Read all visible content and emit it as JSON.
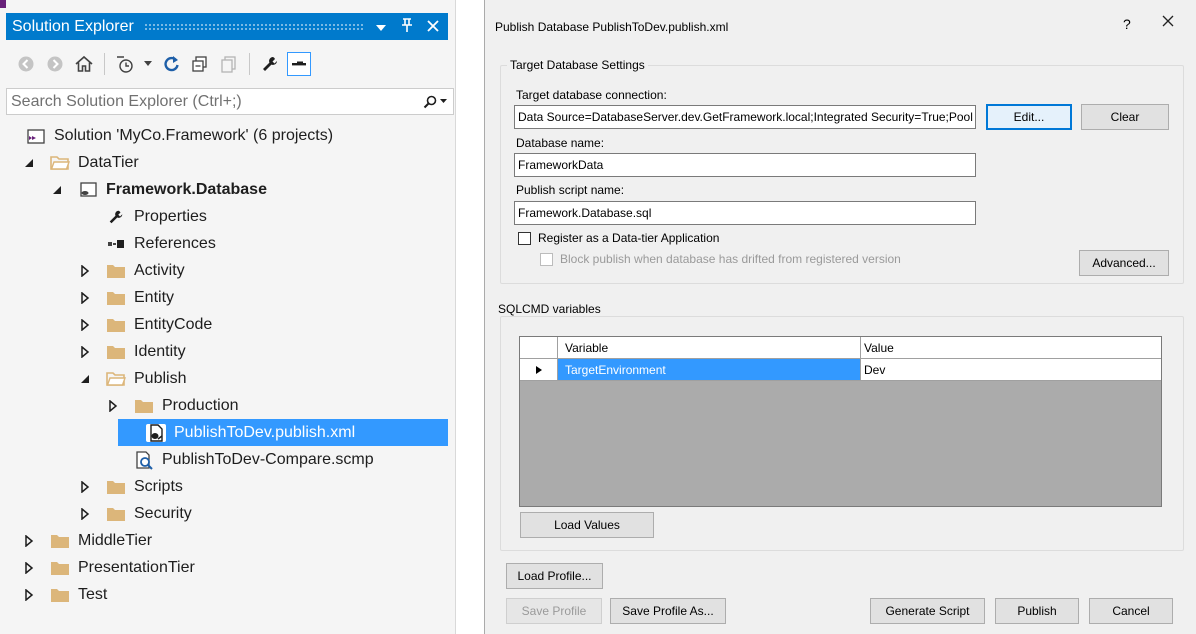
{
  "solution_explorer": {
    "title": "Solution Explorer",
    "search_placeholder": "Search Solution Explorer (Ctrl+;)",
    "tree": [
      {
        "label": "Solution 'MyCo.Framework' (6 projects)",
        "icon": "solution-icon",
        "level": 0,
        "expander": "none",
        "bold": false
      },
      {
        "label": "DataTier",
        "icon": "folder-open-icon",
        "level": 0,
        "expander": "expanded",
        "bold": false
      },
      {
        "label": "Framework.Database",
        "icon": "database-project-icon",
        "level": 1,
        "expander": "expanded",
        "bold": true
      },
      {
        "label": "Properties",
        "icon": "wrench-icon",
        "level": 2,
        "expander": "none",
        "bold": false
      },
      {
        "label": "References",
        "icon": "references-icon",
        "level": 2,
        "expander": "none",
        "bold": false
      },
      {
        "label": "Activity",
        "icon": "folder-icon",
        "level": 2,
        "expander": "collapsed",
        "bold": false
      },
      {
        "label": "Entity",
        "icon": "folder-icon",
        "level": 2,
        "expander": "collapsed",
        "bold": false
      },
      {
        "label": "EntityCode",
        "icon": "folder-icon",
        "level": 2,
        "expander": "collapsed",
        "bold": false
      },
      {
        "label": "Identity",
        "icon": "folder-icon",
        "level": 2,
        "expander": "collapsed",
        "bold": false
      },
      {
        "label": "Publish",
        "icon": "folder-open-icon",
        "level": 2,
        "expander": "expanded",
        "bold": false
      },
      {
        "label": "Production",
        "icon": "folder-icon",
        "level": 3,
        "expander": "collapsed",
        "bold": false
      },
      {
        "label": "PublishToDev.publish.xml",
        "icon": "publish-file-icon",
        "level": 3,
        "expander": "none",
        "bold": false,
        "selected": true
      },
      {
        "label": "PublishToDev-Compare.scmp",
        "icon": "compare-file-icon",
        "level": 3,
        "expander": "none",
        "bold": false
      },
      {
        "label": "Scripts",
        "icon": "folder-icon",
        "level": 2,
        "expander": "collapsed",
        "bold": false
      },
      {
        "label": "Security",
        "icon": "folder-icon",
        "level": 2,
        "expander": "collapsed",
        "bold": false
      },
      {
        "label": "MiddleTier",
        "icon": "folder-icon",
        "level": 0,
        "expander": "collapsed",
        "bold": false
      },
      {
        "label": "PresentationTier",
        "icon": "folder-icon",
        "level": 0,
        "expander": "collapsed",
        "bold": false
      },
      {
        "label": "Test",
        "icon": "folder-icon",
        "level": 0,
        "expander": "collapsed",
        "bold": false
      }
    ]
  },
  "dialog": {
    "title": "Publish Database PublishToDev.publish.xml",
    "help": "?",
    "target_group": "Target Database Settings",
    "connection_label": "Target database connection:",
    "connection_value": "Data Source=DatabaseServer.dev.GetFramework.local;Integrated Security=True;Pool",
    "edit_button": "Edit...",
    "clear_button": "Clear",
    "dbname_label": "Database name:",
    "dbname_value": "FrameworkData",
    "script_label": "Publish script name:",
    "script_value": "Framework.Database.sql",
    "register_label": "Register as a Data-tier Application",
    "block_label": "Block publish when database has drifted from registered version",
    "advanced_button": "Advanced...",
    "sqlcmd_group": "SQLCMD variables",
    "grid": {
      "headers": [
        "Variable",
        "Value"
      ],
      "rows": [
        {
          "variable": "TargetEnvironment",
          "value": "Dev"
        }
      ]
    },
    "load_values_button": "Load Values",
    "load_profile_button": "Load Profile...",
    "save_profile_button": "Save Profile",
    "save_profile_as_button": "Save Profile As...",
    "generate_script_button": "Generate Script",
    "publish_button": "Publish",
    "cancel_button": "Cancel"
  },
  "colors": {
    "accent": "#007acc",
    "selection": "#3399ff",
    "folder": "#dcb67a"
  }
}
